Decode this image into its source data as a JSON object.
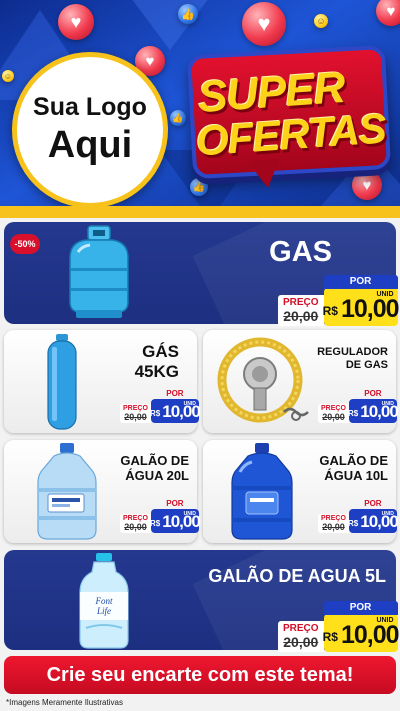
{
  "header": {
    "logo_line1": "Sua Logo",
    "logo_line2": "Aqui",
    "headline_line1": "SUPER",
    "headline_line2": "OFERTAS"
  },
  "badge": "-50%",
  "products": {
    "gas": {
      "title": "GAS",
      "old_label": "PREÇO",
      "old_value": "20,00",
      "por": "POR",
      "unid": "UNID",
      "currency": "R$",
      "price": "10,00",
      "icon": "gas-cylinder-icon"
    },
    "gas45": {
      "title_l1": "GÁS",
      "title_l2": "45KG",
      "old_label": "PREÇO",
      "old_value": "20,00",
      "por": "POR",
      "unid": "UNID",
      "currency": "R$",
      "price": "10,00",
      "icon": "tall-gas-cylinder-icon"
    },
    "regulador": {
      "title_l1": "REGULADOR",
      "title_l2": "DE GAS",
      "old_label": "PREÇO",
      "old_value": "20,00",
      "por": "POR",
      "unid": "UNID",
      "currency": "R$",
      "price": "10,00",
      "icon": "gas-regulator-icon"
    },
    "galao20": {
      "title_l1": "GALÃO DE",
      "title_l2": "ÁGUA 20L",
      "old_label": "PREÇO",
      "old_value": "20,00",
      "por": "POR",
      "unid": "UNID",
      "currency": "R$",
      "price": "10,00",
      "icon": "water-jug-20l-icon"
    },
    "galao10": {
      "title_l1": "GALÃO DE",
      "title_l2": "ÁGUA 10L",
      "old_label": "PREÇO",
      "old_value": "20,00",
      "por": "POR",
      "unid": "UNID",
      "currency": "R$",
      "price": "10,00",
      "icon": "water-jug-10l-icon"
    },
    "galao5": {
      "title": "GALÃO DE AGUA 5L",
      "old_label": "PREÇO",
      "old_value": "20,00",
      "por": "POR",
      "unid": "UNID",
      "currency": "R$",
      "price": "10,00",
      "icon": "water-bottle-5l-icon",
      "brand_line1": "Font",
      "brand_line2": "Life"
    }
  },
  "cta": "Crie seu encarte com este tema!",
  "disclaimer": "*Imagens Meramente Ilustrativas",
  "colors": {
    "brand_blue": "#1d2f80",
    "accent_yellow": "#ffe01a",
    "accent_red": "#d8102c"
  }
}
